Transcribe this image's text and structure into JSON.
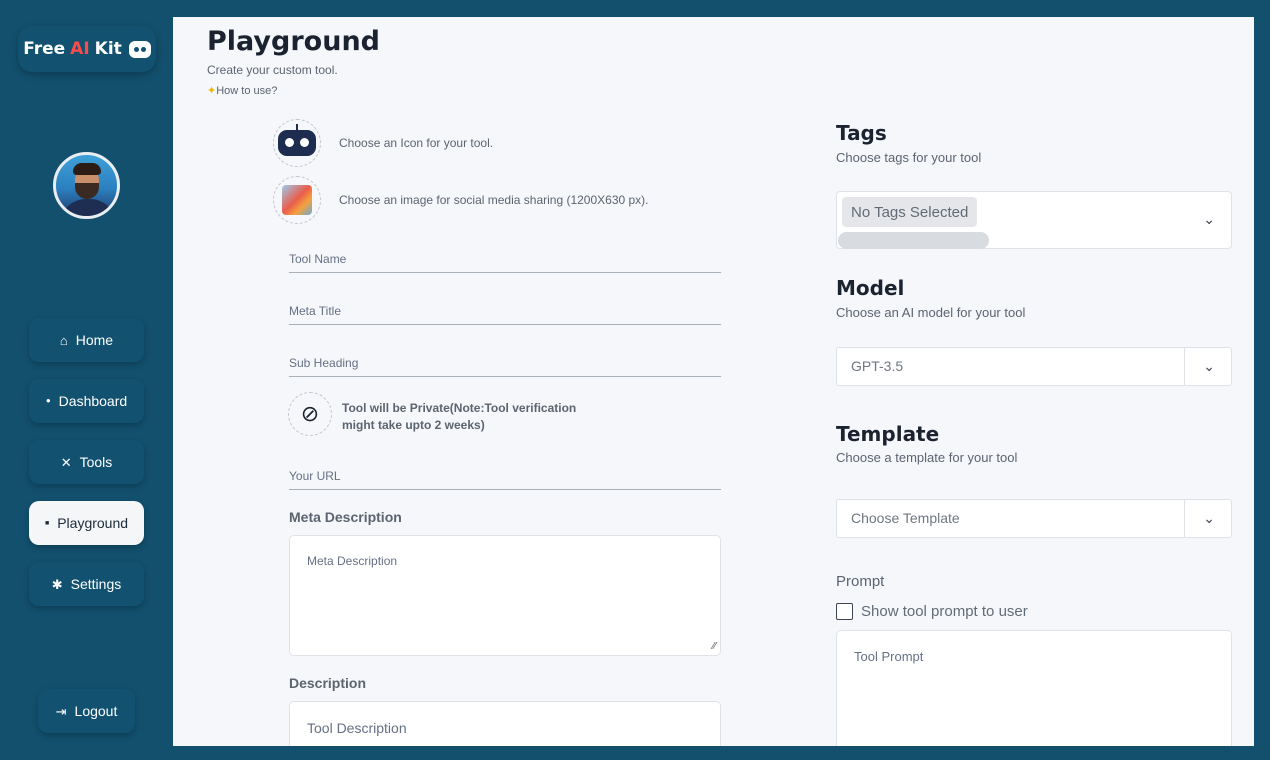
{
  "brand": {
    "part1": "Free",
    "part2": "AI",
    "part3": "Kit"
  },
  "nav": [
    {
      "label": "Home",
      "icon": "home-icon",
      "glyph": "⌂"
    },
    {
      "label": "Dashboard",
      "icon": "dashboard-icon",
      "glyph": "●"
    },
    {
      "label": "Tools",
      "icon": "tools-icon",
      "glyph": "✕"
    },
    {
      "label": "Playground",
      "icon": "playground-icon",
      "glyph": "■"
    },
    {
      "label": "Settings",
      "icon": "settings-icon",
      "glyph": "✱"
    }
  ],
  "logout": "Logout",
  "page": {
    "title": "Playground",
    "subtitle": "Create your custom tool.",
    "how_to": "How to use?"
  },
  "icon_pick": "Choose an Icon for your tool.",
  "image_pick": "Choose an image for social media sharing (1200X630 px).",
  "fields": {
    "tool_name": "Tool Name",
    "meta_title": "Meta Title",
    "sub_heading": "Sub Heading",
    "your_url": "Your URL"
  },
  "private_note": "Tool will be Private(Note:Tool verification might take upto 2 weeks)",
  "meta_description": {
    "label": "Meta Description",
    "placeholder": "Meta Description"
  },
  "description": {
    "label": "Description",
    "placeholder": "Tool Description"
  },
  "tags": {
    "title": "Tags",
    "subtitle": "Choose tags for your tool",
    "chip": "No Tags Selected"
  },
  "model": {
    "title": "Model",
    "subtitle": "Choose an AI model for your tool",
    "value": "GPT-3.5"
  },
  "template": {
    "title": "Template",
    "subtitle": "Choose a template for your tool",
    "placeholder": "Choose Template"
  },
  "prompt": {
    "label": "Prompt",
    "checkbox": "Show tool prompt to user",
    "placeholder": "Tool Prompt"
  },
  "colors": {
    "sidebar": "#12506e",
    "panel": "#f5f7fa",
    "accent": "#ff4a4a"
  }
}
